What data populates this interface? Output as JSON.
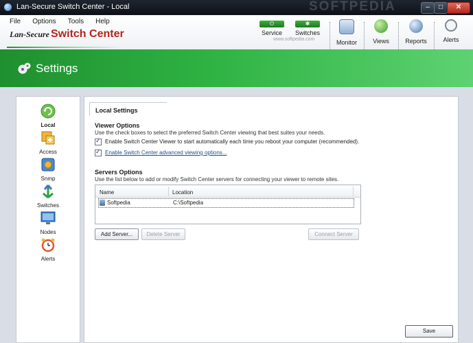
{
  "window": {
    "title": "Lan-Secure Switch Center - Local",
    "watermark": "SOFTPEDIA"
  },
  "menu": [
    "File",
    "Options",
    "Tools",
    "Help"
  ],
  "brand": {
    "lan": "Lan-Secure",
    "product": "Switch Center",
    "url": "www.softpedia.com"
  },
  "status_toggles": [
    {
      "label": "Service",
      "color": "#2f9e2f"
    },
    {
      "label": "Switches",
      "color": "#2f9e2f"
    }
  ],
  "toolbar": [
    "Monitor",
    "Views",
    "Reports",
    "Alerts"
  ],
  "band": {
    "title": "Settings",
    "accent": "#2fb343"
  },
  "nav": [
    {
      "label": "Local",
      "icon": "refresh-icon",
      "active": true
    },
    {
      "label": "Access",
      "icon": "access-icon"
    },
    {
      "label": "Snmp",
      "icon": "snmp-icon"
    },
    {
      "label": "Switches",
      "icon": "switches-icon"
    },
    {
      "label": "Nodes",
      "icon": "monitor-icon"
    },
    {
      "label": "Alerts",
      "icon": "alarm-clock-icon"
    }
  ],
  "main": {
    "tab": "Local Settings",
    "viewer": {
      "title": "Viewer Options",
      "description": "Use the check boxes to select the preferred Switch Center viewing that best suites your needs.",
      "opt_autostart": "Enable Switch Center Viewer to start automatically each time you reboot your computer (recommended).",
      "opt_advanced": "Enable Switch Center advanced viewing options..."
    },
    "servers": {
      "title": "Servers Options",
      "description": "Use the list below to add or modify Switch Center servers for connecting your viewer to remote sites.",
      "col_name": "Name",
      "col_location": "Location",
      "rows": [
        {
          "name": "Softpedia",
          "location": "C:\\Softpedia"
        }
      ]
    },
    "buttons": {
      "add": "Add Server...",
      "delete": "Delete Server",
      "connect": "Connect Server",
      "save": "Save"
    }
  }
}
